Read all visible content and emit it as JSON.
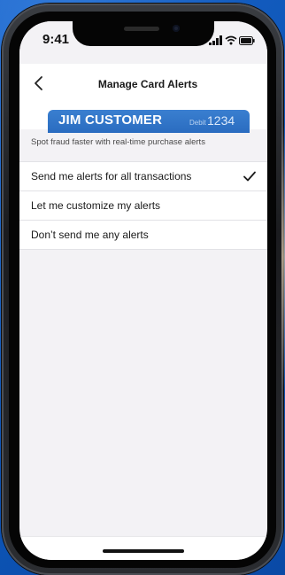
{
  "status_bar": {
    "time": "9:41",
    "icons": [
      "signal-icon",
      "wifi-icon",
      "battery-icon"
    ]
  },
  "nav": {
    "title": "Manage Card Alerts",
    "back_icon": "chevron-left-icon"
  },
  "card": {
    "name": "JIM CUSTOMER",
    "type": "Debit",
    "last_digits": "1234",
    "color": "#2f74c8"
  },
  "subtitle": "Spot fraud faster with real-time purchase alerts",
  "options": [
    {
      "label": "Send me alerts for all transactions",
      "selected": true
    },
    {
      "label": "Let me customize my alerts",
      "selected": false
    },
    {
      "label": "Don’t send me any alerts",
      "selected": false
    }
  ],
  "colors": {
    "background": "#0e56b8",
    "screen": "#f3f2f5",
    "accent": "#2f74c8"
  }
}
